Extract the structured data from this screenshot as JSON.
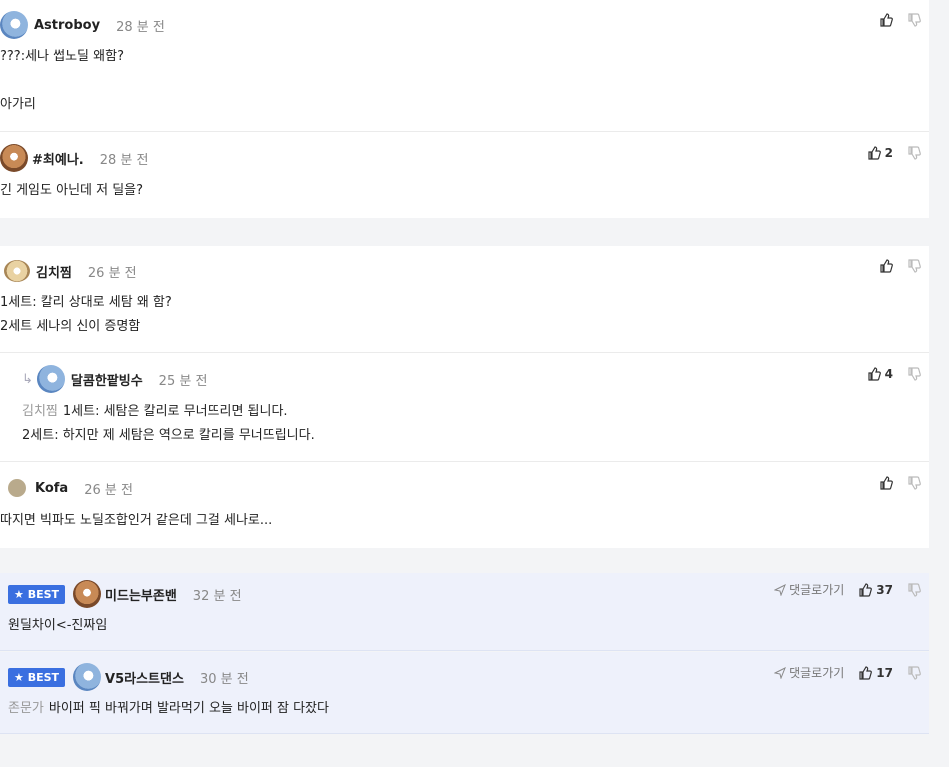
{
  "comments": [
    {
      "nick": "Astroboy",
      "time": "28 분 전",
      "lines": [
        "???:세나 썹노딜 왜함?",
        "",
        "아가리"
      ]
    },
    {
      "nick": "#최예나.",
      "time": "28 분 전",
      "lines": [
        "긴 게임도 아닌데 저 딜을?"
      ],
      "likes": "2"
    },
    {
      "nick": "김치찜",
      "time": "26 분 전",
      "lines": [
        "1세트: 칼리 상대로 세탐 왜 함?",
        "2세트 세나의 신이 증명함"
      ]
    },
    {
      "nick": "달콤한팥빙수",
      "time": "25 분 전",
      "mention": "김치찜",
      "lines": [
        "1세트: 세탐은 칼리로 무너뜨리면 됩니다.",
        "2세트: 하지만 제 세탐은 역으로 칼리를 무너뜨립니다."
      ],
      "likes": "4"
    },
    {
      "nick": "Kofa",
      "time": "26 분 전",
      "lines": [
        "따지면 빅파도 노딜조합인거 같은데 그걸 세나로..."
      ]
    }
  ],
  "best": [
    {
      "badge": "BEST",
      "nick": "미드는부존밴",
      "time": "32 분 전",
      "text": "원딜차이<-진짜임",
      "goto": "댓글로가기",
      "likes": "37"
    },
    {
      "badge": "BEST",
      "nick": "V5라스트댄스",
      "time": "30 분 전",
      "mention": "존문가",
      "text": "바이퍼 픽 바꿔가며 발라먹기 오늘 바이퍼 잠 다잤다",
      "goto": "댓글로가기",
      "likes": "17"
    }
  ]
}
